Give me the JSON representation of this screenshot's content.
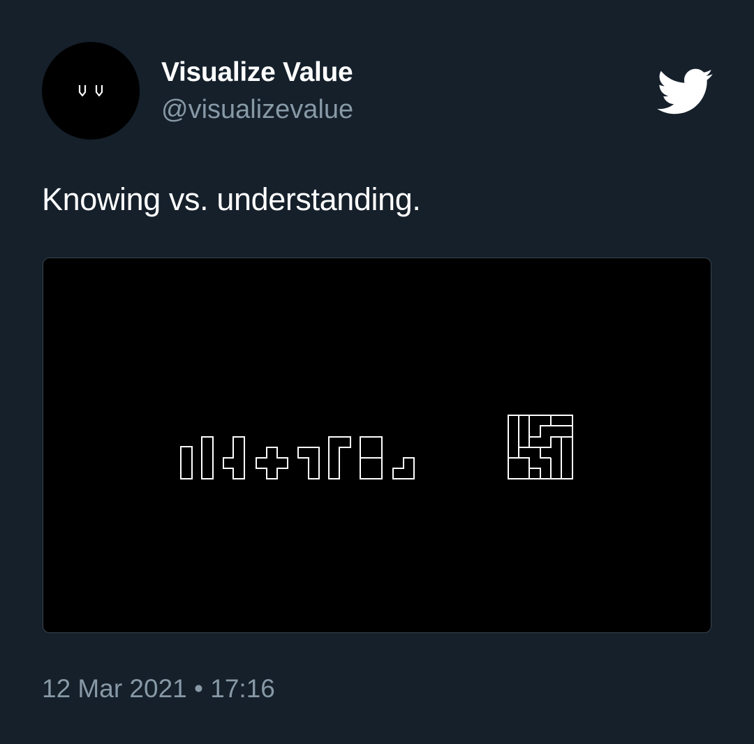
{
  "tweet": {
    "author": {
      "display_name": "Visualize Value",
      "handle": "@visualizevalue",
      "avatar_mark": "VV"
    },
    "text": "Knowing vs. understanding.",
    "timestamp": {
      "date": "12 Mar 2021",
      "separator": "•",
      "time": "17:16"
    },
    "media": {
      "description_icon": "tetromino-pieces-vs-assembled-square"
    }
  },
  "icons": {
    "platform": "twitter-bird-icon"
  },
  "colors": {
    "background": "#15202b",
    "primary_text": "#ffffff",
    "secondary_text": "#8899a6",
    "media_background": "#000000",
    "media_border": "#38444d"
  }
}
